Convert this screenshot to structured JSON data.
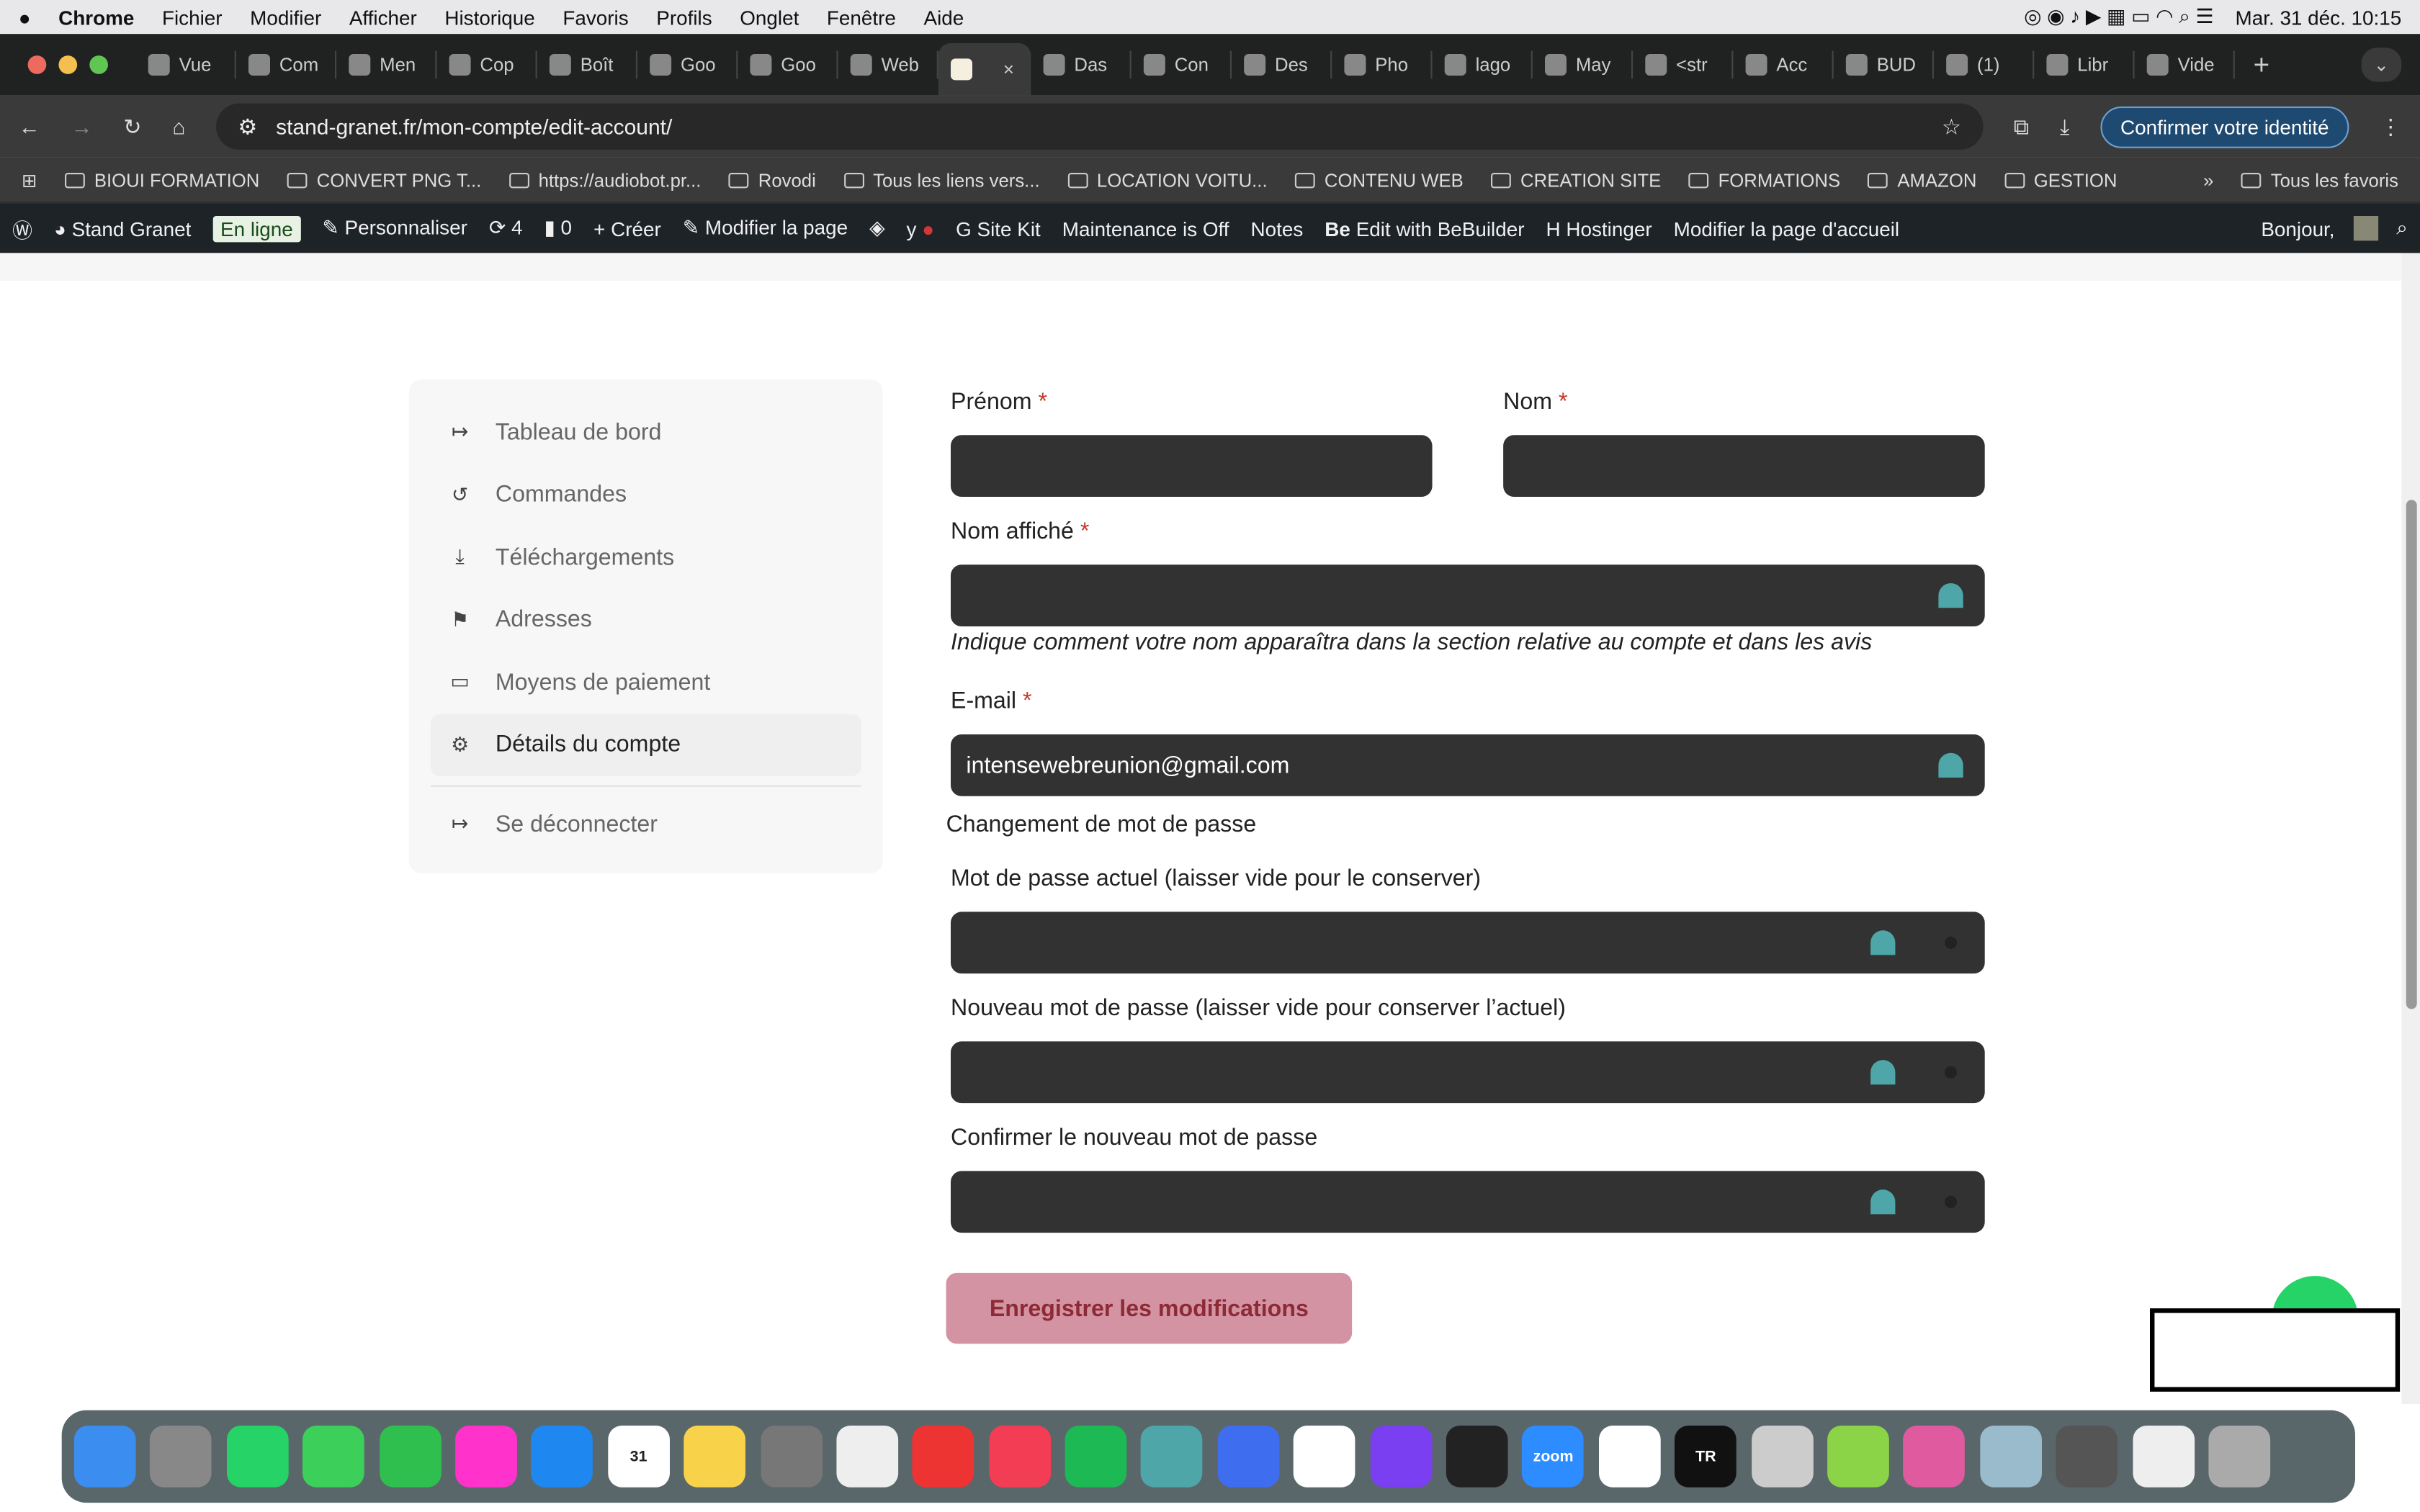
{
  "menubar": {
    "app": "Chrome",
    "items": [
      "Fichier",
      "Modifier",
      "Afficher",
      "Historique",
      "Favoris",
      "Profils",
      "Onglet",
      "Fenêtre",
      "Aide"
    ],
    "datetime": "Mar. 31 déc.  10:15"
  },
  "tabs": [
    {
      "label": "Vue"
    },
    {
      "label": "Com"
    },
    {
      "label": "Men"
    },
    {
      "label": "Cop"
    },
    {
      "label": "Boît"
    },
    {
      "label": "Goo"
    },
    {
      "label": "Goo"
    },
    {
      "label": "Web"
    },
    {
      "label": "",
      "active": true,
      "close": "×"
    },
    {
      "label": "Das"
    },
    {
      "label": "Con"
    },
    {
      "label": "Des"
    },
    {
      "label": "Pho"
    },
    {
      "label": "lago"
    },
    {
      "label": "May"
    },
    {
      "label": "<str"
    },
    {
      "label": "Acc"
    },
    {
      "label": "BUD"
    },
    {
      "label": "(1)"
    },
    {
      "label": "Libr"
    },
    {
      "label": "Vide"
    }
  ],
  "new_tab": "+",
  "toolbar": {
    "url": "stand-granet.fr/mon-compte/edit-account/",
    "identity": "Confirmer votre identité"
  },
  "bookmarks": [
    "BIOUI FORMATION",
    "CONVERT PNG T...",
    "https://audiobot.pr...",
    "Rovodi",
    "Tous les liens vers...",
    "LOCATION VOITU...",
    "CONTENU WEB",
    "CREATION SITE",
    "FORMATIONS",
    "AMAZON",
    "GESTION"
  ],
  "bookmarks_more": "»",
  "all_bookmarks": "Tous les favoris",
  "wpbar": {
    "site": "Stand Granet",
    "status": "En ligne",
    "customize": "Personnaliser",
    "updates": "4",
    "comments": "0",
    "create": "Créer",
    "edit": "Modifier la page",
    "sitekit": "Site Kit",
    "maintenance": "Maintenance is Off",
    "notes": "Notes",
    "bebuilder": "Edit with BeBuilder",
    "hostinger": "Hostinger",
    "edit_home": "Modifier la page d'accueil",
    "greeting": "Bonjour,"
  },
  "sidebar": {
    "items": [
      {
        "label": "Tableau de bord",
        "icon": "↦"
      },
      {
        "label": "Commandes",
        "icon": "↺"
      },
      {
        "label": "Téléchargements",
        "icon": "⤓"
      },
      {
        "label": "Adresses",
        "icon": "⚑"
      },
      {
        "label": "Moyens de paiement",
        "icon": "▭"
      },
      {
        "label": "Détails du compte",
        "icon": "⚙",
        "active": true
      }
    ],
    "logout": {
      "label": "Se déconnecter",
      "icon": "↦"
    }
  },
  "form": {
    "first_name": "Prénom",
    "last_name": "Nom",
    "display_name": "Nom affiché",
    "required": "*",
    "display_hint": "Indique comment votre nom apparaîtra dans la section relative au compte et dans les avis",
    "email_label": "E-mail",
    "email_value": "intensewebreunion@gmail.com",
    "password_section": "Changement de mot de passe",
    "current_pw": "Mot de passe actuel (laisser vide pour le conserver)",
    "new_pw": "Nouveau mot de passe (laisser vide pour conserver l’actuel)",
    "confirm_pw": "Confirmer le nouveau mot de passe",
    "save": "Enregistrer les modifications"
  },
  "colors": {
    "input_bg": "#323232",
    "button_bg": "#d393a3",
    "button_text": "#8d2a36",
    "accent": "#4ea6a9"
  },
  "dock": [
    {
      "name": "Finder",
      "c": "#3b8ef0"
    },
    {
      "name": "Launchpad",
      "c": "#888"
    },
    {
      "name": "WhatsApp",
      "c": "#25d366"
    },
    {
      "name": "Messages",
      "c": "#3ccf5a"
    },
    {
      "name": "FaceTime",
      "c": "#2fbf4f"
    },
    {
      "name": "Photos",
      "c": "#f3c"
    },
    {
      "name": "App Store",
      "c": "#1e88f0"
    },
    {
      "name": "31",
      "c": "#fff"
    },
    {
      "name": "Notes",
      "c": "#f8d34a"
    },
    {
      "name": "Réglages",
      "c": "#777"
    },
    {
      "name": "Freeform",
      "c": "#eee"
    },
    {
      "name": "Chrome",
      "c": "#e33"
    },
    {
      "name": "Musique",
      "c": "#f33d55"
    },
    {
      "name": "Spotify",
      "c": "#1db954"
    },
    {
      "name": "NordVPN",
      "c": "#4ea6a9"
    },
    {
      "name": "NordPass",
      "c": "#3f6df0"
    },
    {
      "name": "CapCut",
      "c": "#fff"
    },
    {
      "name": "Canva",
      "c": "#7b3ff2"
    },
    {
      "name": "Inkscape",
      "c": "#222"
    },
    {
      "name": "zoom",
      "c": "#2d8cff"
    },
    {
      "name": "ChatGPT",
      "c": "#fff"
    },
    {
      "name": "TR",
      "c": "#111"
    },
    {
      "name": "Micro",
      "c": "#ccc"
    },
    {
      "name": "Coda",
      "c": "#8bd448"
    },
    {
      "name": "CleanMyMac",
      "c": "#e05aa0"
    },
    {
      "name": "Aperçu",
      "c": "#9bc"
    },
    {
      "name": "Calculette",
      "c": "#555"
    },
    {
      "name": "Document",
      "c": "#eee"
    },
    {
      "name": "Corbeille",
      "c": "#aaa"
    }
  ]
}
